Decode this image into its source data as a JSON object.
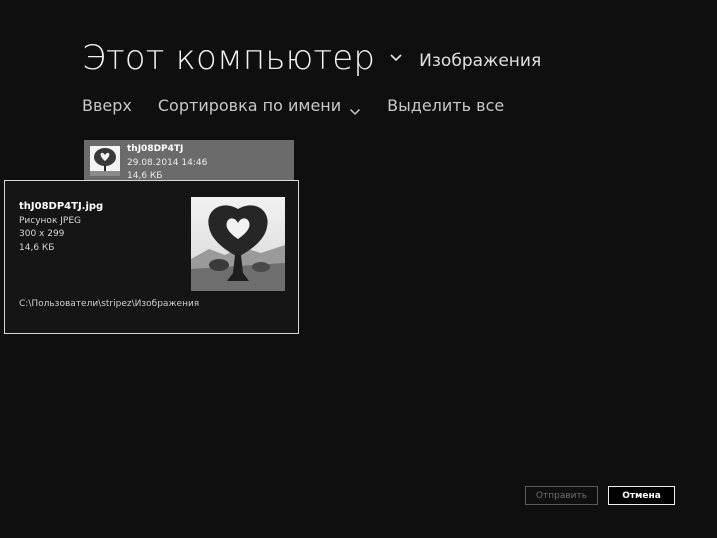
{
  "header": {
    "title": "Этот компьютер",
    "subfolder": "Изображения"
  },
  "commands": {
    "up": "Вверх",
    "sort": "Сортировка по имени",
    "select_all": "Выделить все"
  },
  "file_tile": {
    "name": "thJ08DP4TJ",
    "date": "29.08.2014 14:46",
    "size": "14,6 КБ"
  },
  "popup": {
    "filename": "thJ08DP4TJ.jpg",
    "type": "Рисунок JPEG",
    "dimensions": "300 x 299",
    "size": "14,6 КБ",
    "path": "C:\\Пользователи\\stripez\\Изображения"
  },
  "buttons": {
    "send": "Отправить",
    "cancel": "Отмена"
  },
  "icons": {
    "title_chevron": "chevron-down-icon",
    "sort_chevron": "chevron-down-icon",
    "thumbnail": "heart-tree-thumbnail"
  },
  "colors": {
    "background": "#0f0f0f",
    "tile_selected": "#6b6b6b",
    "popup_border": "#d8d8d8",
    "disabled_text": "#6e6e6e"
  }
}
